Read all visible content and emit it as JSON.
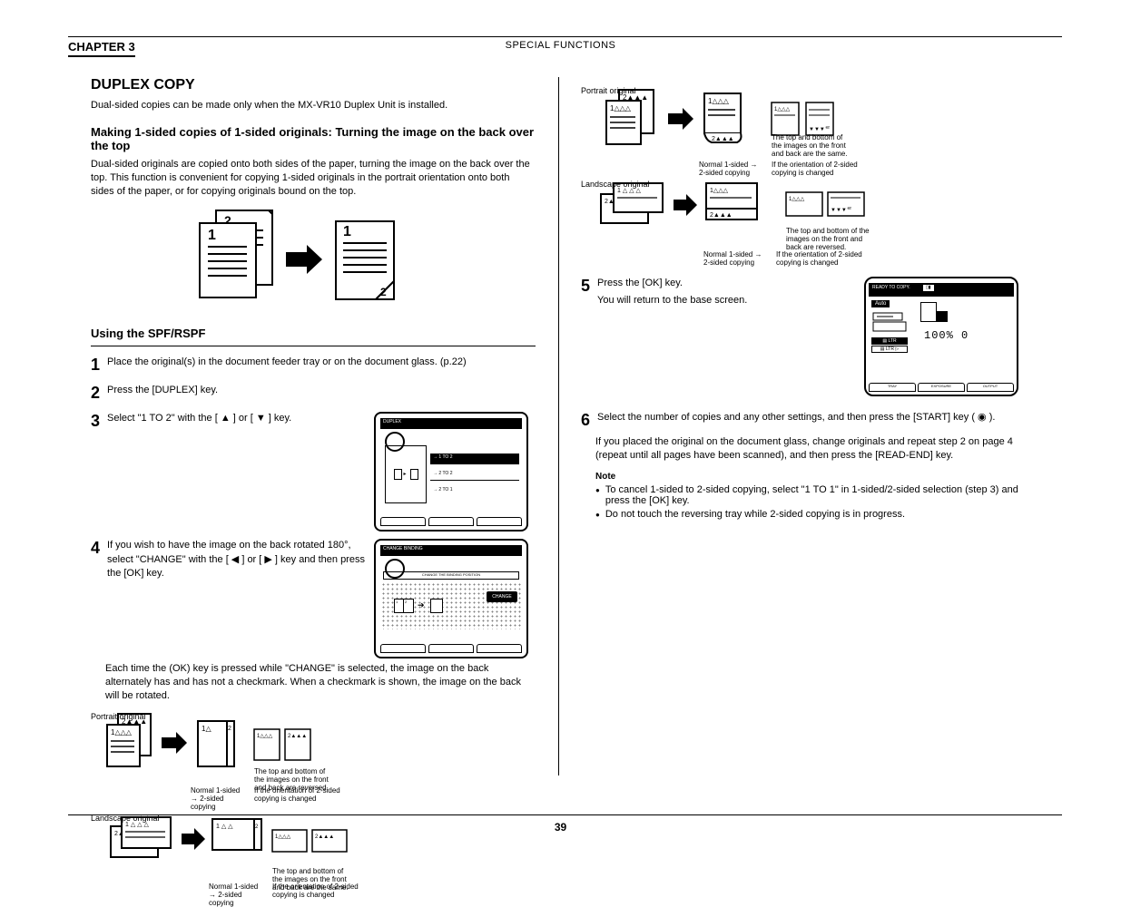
{
  "header": {
    "chapter": "CHAPTER 3",
    "title": "SPECIAL FUNCTIONS"
  },
  "left": {
    "h2": "DUPLEX COPY",
    "it_note": "Dual-sided copies can be made only when the MX-VR10 Duplex Unit is installed.",
    "sub1": "Making 1-sided copies of 1-sided originals: Turning the image on the back over the top",
    "p1": "Dual-sided originals are copied onto both sides of the paper, turning the image on the back over the top. This function is convenient for copying 1-sided originals in the portrait orientation onto both sides of the paper, or for copying originals bound on the top.",
    "fig1_caption": "",
    "sub2": "Using the SPF/RSPF",
    "step1_num": "1",
    "step1": "Place the original(s) in the document feeder tray or on the document  glass. (p.22)",
    "step2_num": "2",
    "step2_a": "Press the [DUPLEX] key.",
    "step3_num": "3",
    "step3": "Select \"1 TO 2\" with the [ ▲ ] or [ ▼ ] key.",
    "step4_num": "4",
    "step4": "If you wish to have the image on the back rotated 180°, select \"CHANGE\" with the [ ◀ ] or [ ▶ ] key and then press the [OK] key.",
    "lcd1": {
      "title": "DUPLEX",
      "opt1": "1 TO 2",
      "opt2": "2 TO 2",
      "opt3": "2 TO 1"
    },
    "lcd2": {
      "title": "CHANGE BINDING",
      "hint": "CHANGE THE BINDING POSITION",
      "btn": "CHANGE"
    },
    "p_change": "Each time the (OK) key is pressed while \"CHANGE\" is selected, the image on the back alternately has and has not a checkmark. When a checkmark is shown, the image on the back will be rotated.",
    "fig_port_label": "Portrait original",
    "fig_land_label": "Landscape original",
    "fig_port_results": "The top and bottom of the images on the front and back are reversed.",
    "fig_port_normal": "Normal 1-sided → 2-sided copying",
    "fig_port_change": "If the orientation of 2-sided copying is changed",
    "fig_land_results": "The top and bottom of the images on the front and back are the same.",
    "fig_land_normal": "Normal 1-sided → 2-sided copying",
    "fig_land_change": "If the orientation of 2-sided copying is changed"
  },
  "right": {
    "fig_port_label": "Portrait original",
    "fig_land_label": "Landscape original",
    "fig_port_results": "The top and bottom of the images on the front and back are the same.",
    "fig_port_normal": "Normal 1-sided → 2-sided copying",
    "fig_port_change": "If the orientation of 2-sided copying is changed",
    "fig_land_results": "The top and bottom of the images on the front and back are reversed.",
    "fig_land_normal": "Normal 1-sided → 2-sided copying",
    "fig_land_change": "If the orientation of 2-sided copying is changed",
    "step5_num": "5",
    "step5": "Press the [OK] key.",
    "step5b": "You will return to the base screen.",
    "lcd_main": {
      "title": "READY TO COPY.",
      "flag": "▯▮",
      "auto": "Auto",
      "ltr": "LTR",
      "digits": "100% 0",
      "tab1": "TRAY",
      "tab2": "EXPOSURE",
      "tab3": "OUTPUT"
    },
    "step6_num": "6",
    "step6": "Select the number of copies and any other settings, and then press the [START] key ( ◉ ).",
    "note1": "If you placed the original on the document glass, change originals and repeat step 2 on page 4 (repeat until all pages have been scanned), and then press the [READ-END] key.",
    "note_label": "Note",
    "bullet1": "To cancel 1-sided to 2-sided copying, select \"1 TO 1\" in 1-sided/2-sided selection (step 3) and press the [OK] key.",
    "bullet2": "Do not touch the reversing tray while 2-sided copying is in progress."
  },
  "footer": {
    "page": "39"
  }
}
